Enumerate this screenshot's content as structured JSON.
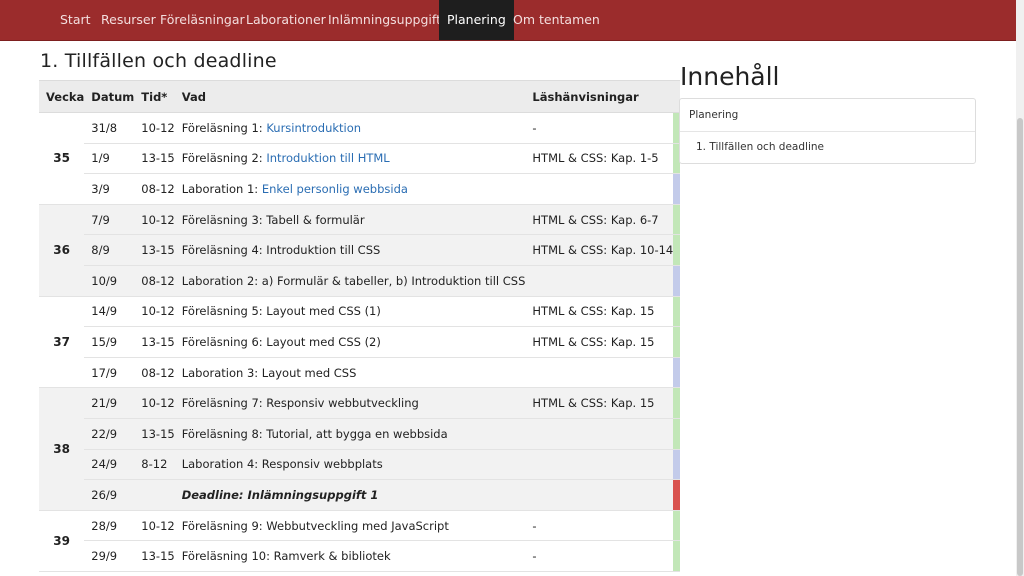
{
  "nav": {
    "items": [
      "Start",
      "Resurser",
      "Föreläsningar",
      "Laborationer",
      "Inlämningsuppgifter",
      "Planering",
      "Om tentamen"
    ],
    "active": "Planering",
    "color": "#9b2c2c"
  },
  "section": {
    "title": "1. Tillfällen och deadline"
  },
  "table": {
    "headers": [
      "Vecka",
      "Datum",
      "Tid*",
      "Vad",
      "Läshänvisningar"
    ],
    "weeks": [
      {
        "week": "35",
        "rows": [
          {
            "date": "31/8",
            "time": "10-12",
            "prefix": "Föreläsning 1: ",
            "link": "Kursintroduktion",
            "reading": "-",
            "kind": "lecture"
          },
          {
            "date": "1/9",
            "time": "13-15",
            "prefix": "Föreläsning 2: ",
            "link": "Introduktion till HTML",
            "reading": "HTML & CSS: Kap. 1-5",
            "kind": "lecture"
          },
          {
            "date": "3/9",
            "time": "08-12",
            "prefix": "Laboration 1: ",
            "link": "Enkel personlig webbsida",
            "reading": "",
            "kind": "lab"
          }
        ]
      },
      {
        "week": "36",
        "rows": [
          {
            "date": "7/9",
            "time": "10-12",
            "prefix": "Föreläsning 3: Tabell & formulär",
            "link": "",
            "reading": "HTML & CSS: Kap. 6-7",
            "kind": "lecture"
          },
          {
            "date": "8/9",
            "time": "13-15",
            "prefix": "Föreläsning 4: Introduktion till CSS",
            "link": "",
            "reading": "HTML & CSS: Kap. 10-14",
            "kind": "lecture"
          },
          {
            "date": "10/9",
            "time": "08-12",
            "prefix": "Laboration 2: a) Formulär & tabeller, b) Introduktion till CSS",
            "link": "",
            "reading": "",
            "kind": "lab"
          }
        ]
      },
      {
        "week": "37",
        "rows": [
          {
            "date": "14/9",
            "time": "10-12",
            "prefix": "Föreläsning 5: Layout med CSS (1)",
            "link": "",
            "reading": "HTML & CSS: Kap. 15",
            "kind": "lecture"
          },
          {
            "date": "15/9",
            "time": "13-15",
            "prefix": "Föreläsning 6: Layout med CSS (2)",
            "link": "",
            "reading": "HTML & CSS: Kap. 15",
            "kind": "lecture"
          },
          {
            "date": "17/9",
            "time": "08-12",
            "prefix": "Laboration 3: Layout med CSS",
            "link": "",
            "reading": "",
            "kind": "lab"
          }
        ]
      },
      {
        "week": "38",
        "rows": [
          {
            "date": "21/9",
            "time": "10-12",
            "prefix": "Föreläsning 7: Responsiv webbutveckling",
            "link": "",
            "reading": "HTML & CSS: Kap. 15",
            "kind": "lecture"
          },
          {
            "date": "22/9",
            "time": "13-15",
            "prefix": "Föreläsning 8: Tutorial, att bygga en webbsida",
            "link": "",
            "reading": "",
            "kind": "lecture"
          },
          {
            "date": "24/9",
            "time": "8-12",
            "prefix": "Laboration 4: Responsiv webbplats",
            "link": "",
            "reading": "",
            "kind": "lab"
          },
          {
            "date": "26/9",
            "time": "",
            "prefix": "Deadline: Inlämningsuppgift 1",
            "link": "",
            "reading": "",
            "kind": "deadline"
          }
        ]
      },
      {
        "week": "39",
        "rows": [
          {
            "date": "28/9",
            "time": "10-12",
            "prefix": "Föreläsning 9: Webbutveckling med JavaScript",
            "link": "",
            "reading": "-",
            "kind": "lecture"
          },
          {
            "date": "29/9",
            "time": "13-15",
            "prefix": "Föreläsning 10: Ramverk & bibliotek",
            "link": "",
            "reading": "-",
            "kind": "lecture"
          }
        ]
      }
    ]
  },
  "toc": {
    "title": "Innehåll",
    "items": [
      "Planering",
      "1. Tillfällen och deadline"
    ]
  },
  "colors": {
    "lecture_marker": "#c2e7b8",
    "lab_marker": "#c3cbea",
    "deadline_marker": "#d9534f",
    "link": "#2a6db3"
  }
}
